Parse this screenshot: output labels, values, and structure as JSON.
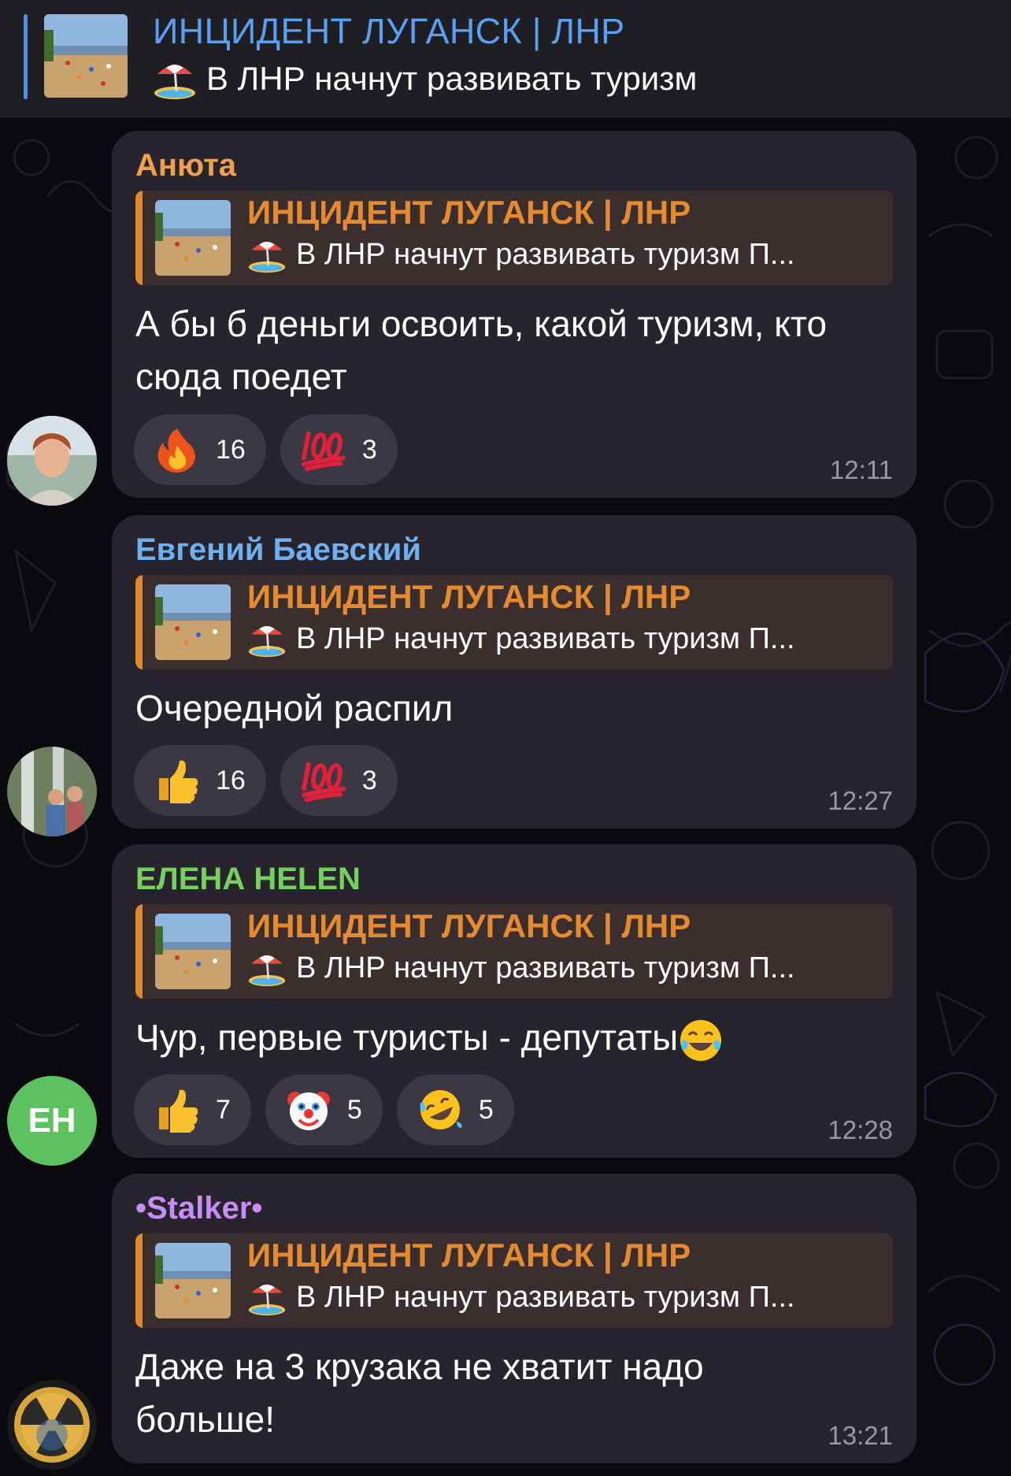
{
  "pinned": {
    "title": "ИНЦИДЕНТ ЛУГАНСК | ЛНР",
    "subtitle": "В ЛНР начнут развивать туризм",
    "icon": "beach-umbrella-icon"
  },
  "reply_preview": {
    "title": "ИНЦИДЕНТ ЛУГАНСК | ЛНР",
    "subtitle": "В ЛНР начнут развивать туризм П..."
  },
  "colors": {
    "author_anyuta": "#f0a04b",
    "author_evgeniy": "#6fb0f0",
    "author_elena": "#74d25c",
    "author_stalker": "#c78cf5",
    "reply_bar": "#e28a2b",
    "pinned_bar": "#4f8fe8"
  },
  "messages": [
    {
      "author": "Анюта",
      "text": "А бы б деньги освоить, какой туризм, кто сюда поедет",
      "time": "12:11",
      "reactions": [
        {
          "icon": "fire-icon",
          "count": "16"
        },
        {
          "icon": "hundred-icon",
          "count": "3"
        }
      ]
    },
    {
      "author": "Евгений Баевский",
      "text": "Очередной распил",
      "time": "12:27",
      "reactions": [
        {
          "icon": "thumbs-up-icon",
          "count": "16"
        },
        {
          "icon": "hundred-icon",
          "count": "3"
        }
      ]
    },
    {
      "author": "ЕЛЕНА HELEN",
      "avatar_initials": "ЕН",
      "text": "Чур, первые туристы - депутаты",
      "time": "12:28",
      "reactions": [
        {
          "icon": "thumbs-up-icon",
          "count": "7"
        },
        {
          "icon": "clown-icon",
          "count": "5"
        },
        {
          "icon": "rofl-icon",
          "count": "5"
        }
      ]
    },
    {
      "author": "•Stalker•",
      "text": "Даже на 3 крузака не хватит надо больше!",
      "time": "13:21",
      "reactions": []
    }
  ]
}
